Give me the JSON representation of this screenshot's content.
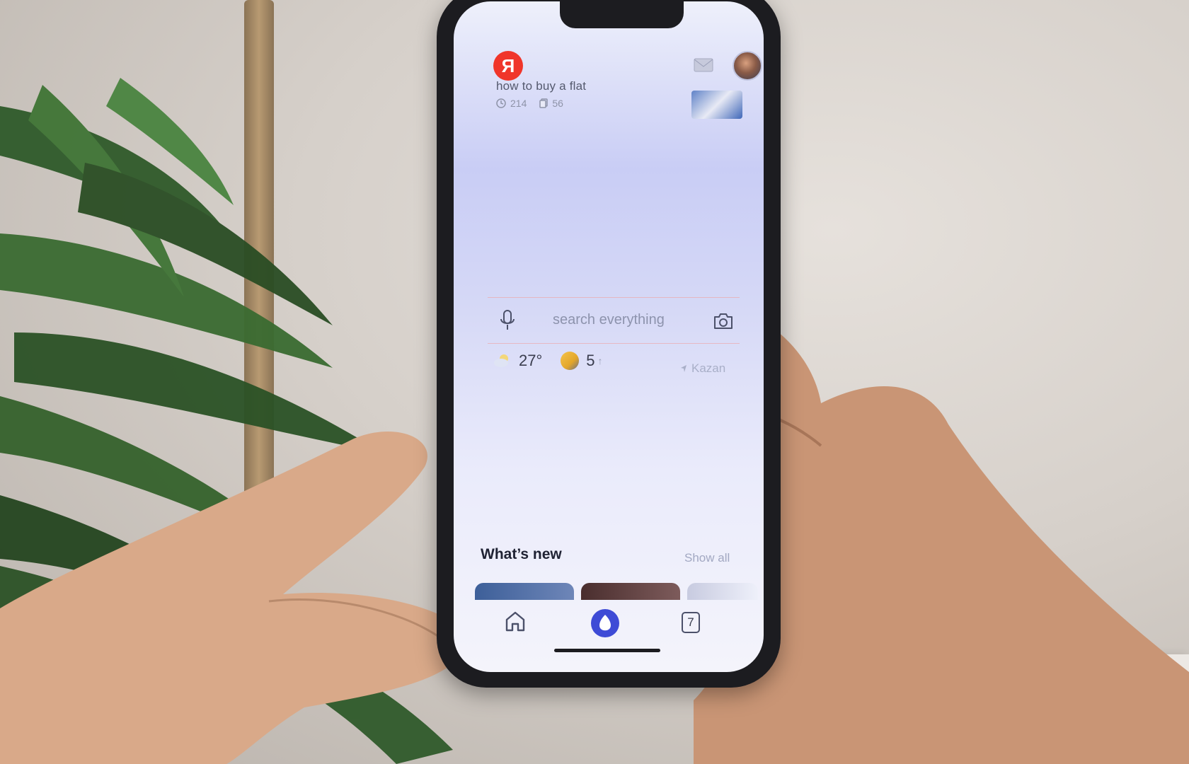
{
  "app": {
    "logo_letter": "Я",
    "brand_color": "#f0352a"
  },
  "article": {
    "title": "how to buy a flat",
    "views": "214",
    "copies": "56"
  },
  "search": {
    "placeholder": "search everything"
  },
  "weather": {
    "temperature": "27°",
    "index_value": "5",
    "index_arrow": "↑",
    "city": "Kazan"
  },
  "whats_new": {
    "title": "What’s new",
    "show_all_label": "Show all"
  },
  "tabbar": {
    "tabs_count": "7"
  },
  "icons": [
    "yandex-logo",
    "mail-icon",
    "avatar",
    "clock-icon",
    "copy-icon",
    "mic-icon",
    "camera-icon",
    "weather-icon",
    "aqi-icon",
    "location-icon",
    "home-icon",
    "alice-icon",
    "tabs-icon"
  ]
}
